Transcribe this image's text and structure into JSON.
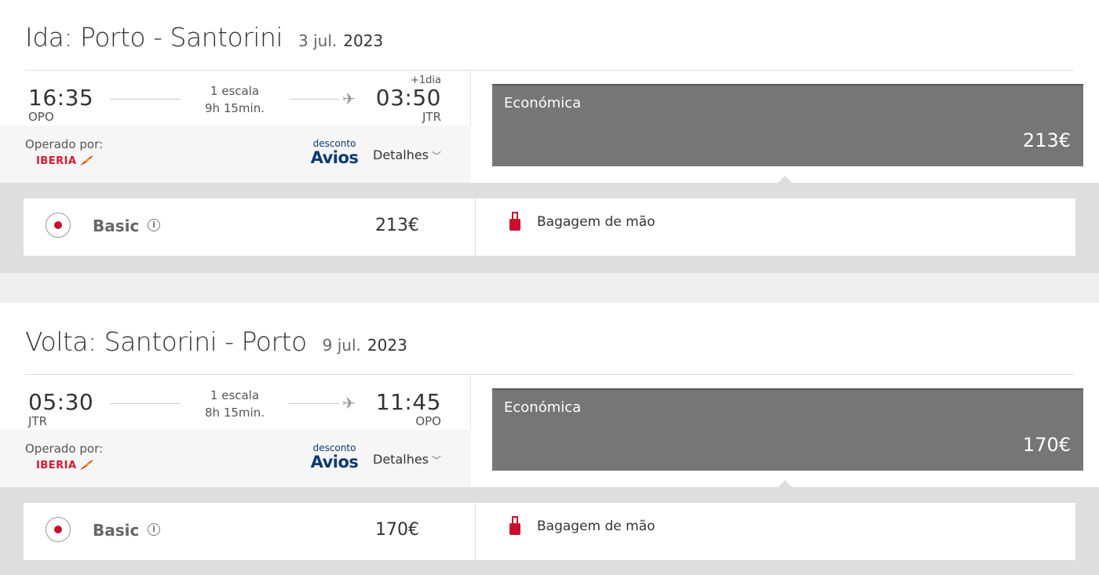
{
  "outbound": {
    "route": "Ida: Porto - Santorini",
    "date": "3 jul.",
    "year": "2023",
    "departure_time": "16:35",
    "departure_code": "OPO",
    "stops": "1 escala",
    "duration": "9h 15min.",
    "day_offset": "+1dia",
    "arrival_time": "03:50",
    "arrival_code": "JTR",
    "operated_by": "Operado por:",
    "airline": "IBERIA",
    "avios_small": "desconto",
    "avios_big": "Avios",
    "details": "Detalhes",
    "cabin": "Económica",
    "cabin_price": "213€",
    "fare_name": "Basic",
    "fare_price": "213€",
    "baggage": "Bagagem de mão"
  },
  "return": {
    "route": "Volta: Santorini - Porto",
    "date": "9 jul.",
    "year": "2023",
    "departure_time": "05:30",
    "departure_code": "JTR",
    "stops": "1 escala",
    "duration": "8h 15min.",
    "day_offset": "",
    "arrival_time": "11:45",
    "arrival_code": "OPO",
    "operated_by": "Operado por:",
    "airline": "IBERIA",
    "avios_small": "desconto",
    "avios_big": "Avios",
    "details": "Detalhes",
    "cabin": "Económica",
    "cabin_price": "170€",
    "fare_name": "Basic",
    "fare_price": "170€",
    "baggage": "Bagagem de mão"
  },
  "colors": {
    "brand_red": "#c8102e",
    "cabin_bg": "#767676",
    "avios_blue": "#0b3a73"
  },
  "icons": [
    "plane-icon",
    "chevron-down-icon",
    "info-icon",
    "suitcase-icon",
    "iberia-logo",
    "radio-selected"
  ]
}
